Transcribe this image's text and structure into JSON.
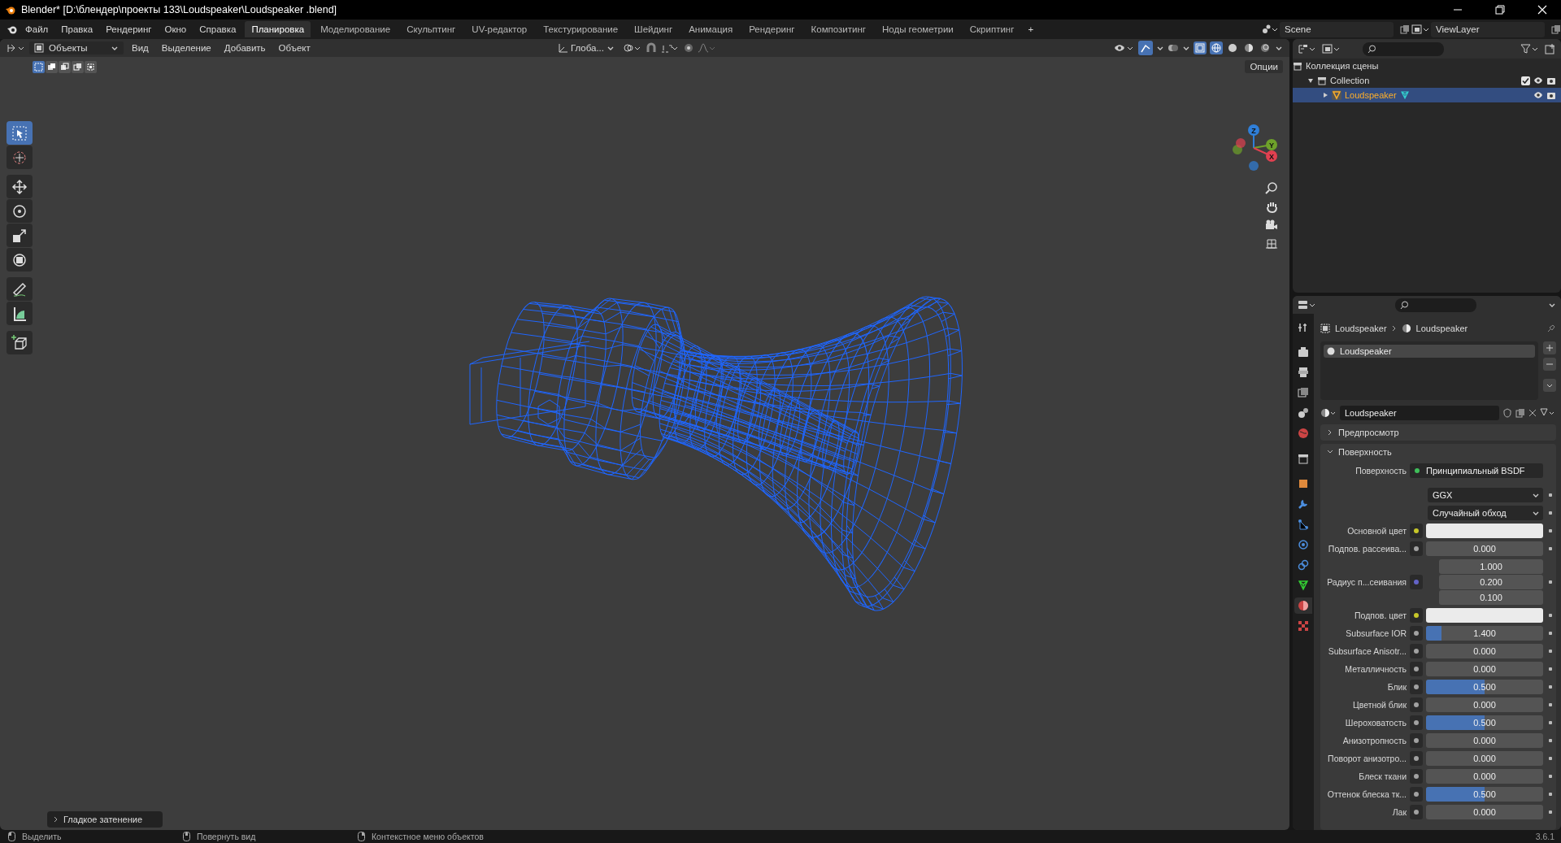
{
  "window": {
    "title": "Blender* [D:\\блендер\\проекты 133\\Loudspeaker\\Loudspeaker .blend]"
  },
  "menu": [
    "Файл",
    "Правка",
    "Рендеринг",
    "Окно",
    "Справка"
  ],
  "workspaces": [
    {
      "label": "Планировка",
      "selected": true
    },
    {
      "label": "Моделирование",
      "selected": false
    },
    {
      "label": "Скульптинг",
      "selected": false
    },
    {
      "label": "UV-редактор",
      "selected": false
    },
    {
      "label": "Текстурирование",
      "selected": false
    },
    {
      "label": "Шейдинг",
      "selected": false
    },
    {
      "label": "Анимация",
      "selected": false
    },
    {
      "label": "Рендеринг",
      "selected": false
    },
    {
      "label": "Композитинг",
      "selected": false
    },
    {
      "label": "Ноды геометрии",
      "selected": false
    },
    {
      "label": "Скриптинг",
      "selected": false
    }
  ],
  "add_workspace": "+",
  "scene": "Scene",
  "view_layer": "ViewLayer",
  "viewport": {
    "mode": "Объекты",
    "menus": [
      "Вид",
      "Выделение",
      "Добавить",
      "Объект"
    ],
    "orientation": "Глоба...",
    "options": "Опции",
    "select_modes": [
      {
        "selected": true
      },
      {
        "selected": false
      },
      {
        "selected": false
      },
      {
        "selected": false
      },
      {
        "selected": false
      }
    ],
    "gizmos": true,
    "xray": true,
    "shading": [
      {
        "kind": "wireframe",
        "selected": true
      },
      {
        "kind": "solid",
        "selected": false
      },
      {
        "kind": "material",
        "selected": false
      },
      {
        "kind": "rendered",
        "selected": false
      }
    ],
    "tools": [
      {
        "kind": "select",
        "selected": true
      },
      {
        "kind": "cursor",
        "selected": false
      },
      {
        "kind": "move",
        "selected": false
      },
      {
        "kind": "rotate",
        "selected": false
      },
      {
        "kind": "scale",
        "selected": false
      },
      {
        "kind": "transform",
        "selected": false
      },
      {
        "kind": "annotate",
        "selected": false
      },
      {
        "kind": "measure",
        "selected": false
      },
      {
        "kind": "add-cube",
        "selected": false
      }
    ],
    "axes": [
      {
        "label": "Z",
        "color": "#2f7fd9"
      },
      {
        "label": "Y",
        "color": "#6ea12a"
      },
      {
        "label": "X",
        "color": "#e04050"
      }
    ],
    "last_operation": "Гладкое затенение"
  },
  "outliner": {
    "items": [
      {
        "label": "Коллекция сцены",
        "kind": "scene-collection",
        "children": [
          {
            "label": "Collection",
            "kind": "collection",
            "expanded": true,
            "checked": true,
            "children": [
              {
                "label": "Loudspeaker",
                "kind": "object",
                "expanded": false,
                "selected": true
              }
            ]
          }
        ]
      }
    ]
  },
  "properties": {
    "tabs": [
      {
        "kind": "tool",
        "selected": false
      },
      {
        "kind": "render",
        "selected": false
      },
      {
        "kind": "output",
        "selected": false
      },
      {
        "kind": "view-layer",
        "selected": false
      },
      {
        "kind": "scene",
        "selected": false
      },
      {
        "kind": "world",
        "selected": false
      },
      {
        "kind": "collection",
        "selected": false
      },
      {
        "kind": "object",
        "selected": false
      },
      {
        "kind": "modifier",
        "selected": false
      },
      {
        "kind": "particles",
        "selected": false
      },
      {
        "kind": "physics",
        "selected": false
      },
      {
        "kind": "constraints",
        "selected": false
      },
      {
        "kind": "data",
        "selected": false
      },
      {
        "kind": "material",
        "selected": true
      },
      {
        "kind": "texture",
        "selected": false
      }
    ],
    "breadcrumb": [
      "Loudspeaker",
      "Loudspeaker"
    ],
    "slots": [
      {
        "label": "Loudspeaker",
        "selected": true
      }
    ],
    "material": "Loudspeaker",
    "panels": [
      {
        "label": "Предпросмотр",
        "expanded": false
      },
      {
        "label": "Поверхность",
        "expanded": true
      }
    ],
    "rows": [
      {
        "kind": "link",
        "label": "Поверхность",
        "value": "Принципиальный BSDF",
        "color": "#3fbf5a"
      },
      {
        "kind": "dropdown",
        "value": "GGX"
      },
      {
        "kind": "dropdown",
        "value": "Случайный обход"
      },
      {
        "kind": "color",
        "label": "Основной цвет",
        "color": "#c7c729"
      },
      {
        "kind": "value",
        "label": "Подпов. рассеива...",
        "value": "0.000",
        "level": 0,
        "color": "#a1a1a1"
      },
      {
        "kind": "vector",
        "label": "Радиус п...сеивания",
        "values": [
          "1.000",
          "0.200",
          "0.100"
        ],
        "color": "#6363c7"
      },
      {
        "kind": "color",
        "label": "Подпов. цвет",
        "color": "#c7c729"
      },
      {
        "kind": "value",
        "label": "Subsurface IOR",
        "value": "1.400",
        "level": 0.13,
        "color": "#a1a1a1"
      },
      {
        "kind": "value",
        "label": "Subsurface Anisotr...",
        "value": "0.000",
        "level": 0,
        "color": "#a1a1a1"
      },
      {
        "kind": "value",
        "label": "Металличность",
        "value": "0.000",
        "level": 0,
        "color": "#a1a1a1"
      },
      {
        "kind": "value",
        "label": "Блик",
        "value": "0.500",
        "level": 0.5,
        "color": "#a1a1a1"
      },
      {
        "kind": "value",
        "label": "Цветной блик",
        "value": "0.000",
        "level": 0,
        "color": "#a1a1a1"
      },
      {
        "kind": "value",
        "label": "Шероховатость",
        "value": "0.500",
        "level": 0.5,
        "color": "#a1a1a1"
      },
      {
        "kind": "value",
        "label": "Анизотропность",
        "value": "0.000",
        "level": 0,
        "color": "#a1a1a1"
      },
      {
        "kind": "value",
        "label": "Поворот анизотро...",
        "value": "0.000",
        "level": 0,
        "color": "#a1a1a1"
      },
      {
        "kind": "value",
        "label": "Блеск ткани",
        "value": "0.000",
        "level": 0,
        "color": "#a1a1a1"
      },
      {
        "kind": "value",
        "label": "Оттенок блеска тк...",
        "value": "0.500",
        "level": 0.5,
        "color": "#a1a1a1"
      },
      {
        "kind": "value",
        "label": "Лак",
        "value": "0.000",
        "level": 0,
        "color": "#a1a1a1"
      }
    ]
  },
  "status_bar": {
    "hints": [
      "Выделить",
      "Повернуть вид",
      "Контекстное меню объектов"
    ],
    "version": "3.6.1"
  }
}
